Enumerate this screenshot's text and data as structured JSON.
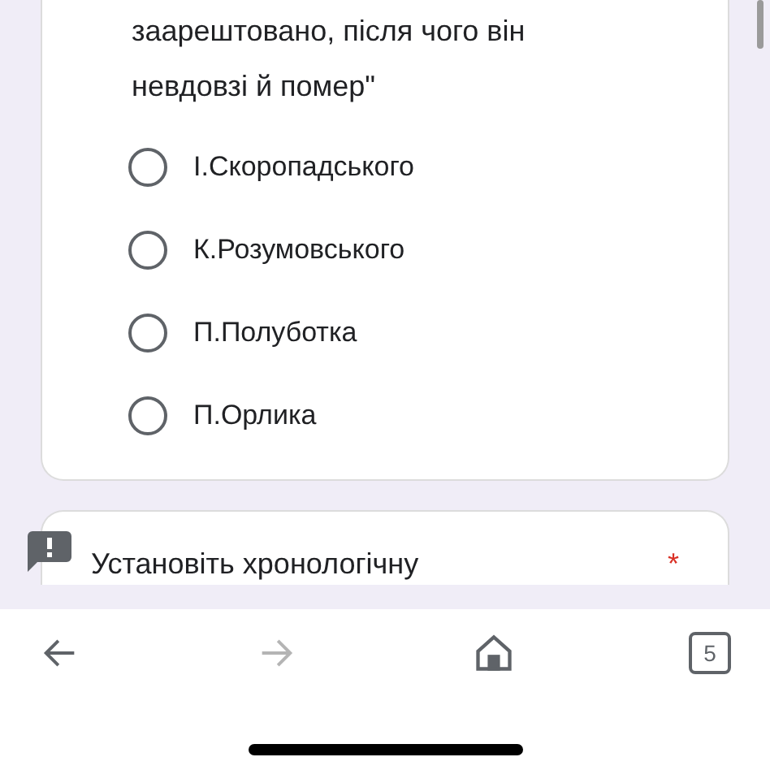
{
  "question": {
    "lines": [
      "заарештовано, після чого він",
      "невдовзі й помер\""
    ]
  },
  "options": [
    {
      "label": "І.Скоропадського",
      "selected": false
    },
    {
      "label": "К.Розумовського",
      "selected": false
    },
    {
      "label": "П.Полуботка",
      "selected": false
    },
    {
      "label": "П.Орлика",
      "selected": false
    }
  ],
  "next_question": {
    "title": "Установіть хронологічну",
    "required_mark": "*"
  },
  "toolbar": {
    "tab_count": "5",
    "forward_disabled": true
  }
}
